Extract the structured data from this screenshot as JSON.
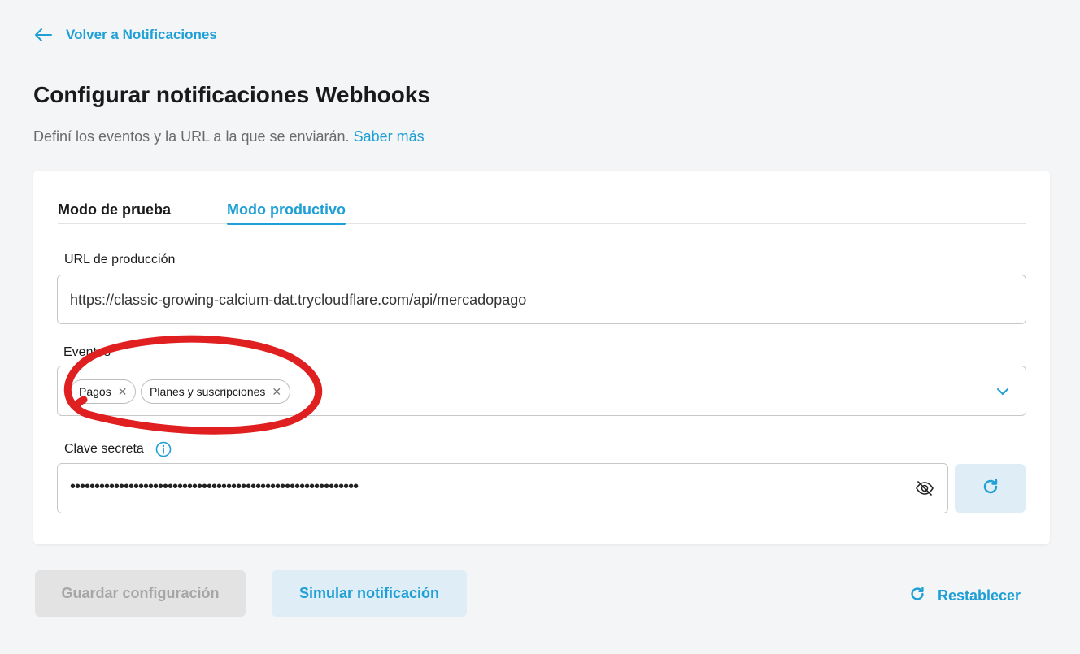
{
  "nav": {
    "back_label": "Volver a Notificaciones"
  },
  "header": {
    "title": "Configurar notificaciones Webhooks",
    "subtitle": "Definí los eventos y la URL a la que se enviarán.",
    "learn_more": "Saber más"
  },
  "tabs": [
    {
      "label": "Modo de prueba",
      "active": false
    },
    {
      "label": "Modo productivo",
      "active": true
    }
  ],
  "url_field": {
    "label": "URL de producción",
    "value": "https://classic-growing-calcium-dat.trycloudflare.com/api/mercadopago"
  },
  "events_field": {
    "label": "Eventos",
    "chips": [
      "Pagos",
      "Planes y suscripciones"
    ]
  },
  "secret_field": {
    "label": "Clave secreta",
    "masked_value": "•••••••••••••••••••••••••••••••••••••••••••••••••••••••••••"
  },
  "actions": {
    "save_label": "Guardar configuración",
    "simulate_label": "Simular notificación",
    "reset_label": "Restablecer"
  },
  "colors": {
    "accent": "#1e9fd6",
    "annotation": "#e02020",
    "background": "#f4f5f7"
  }
}
